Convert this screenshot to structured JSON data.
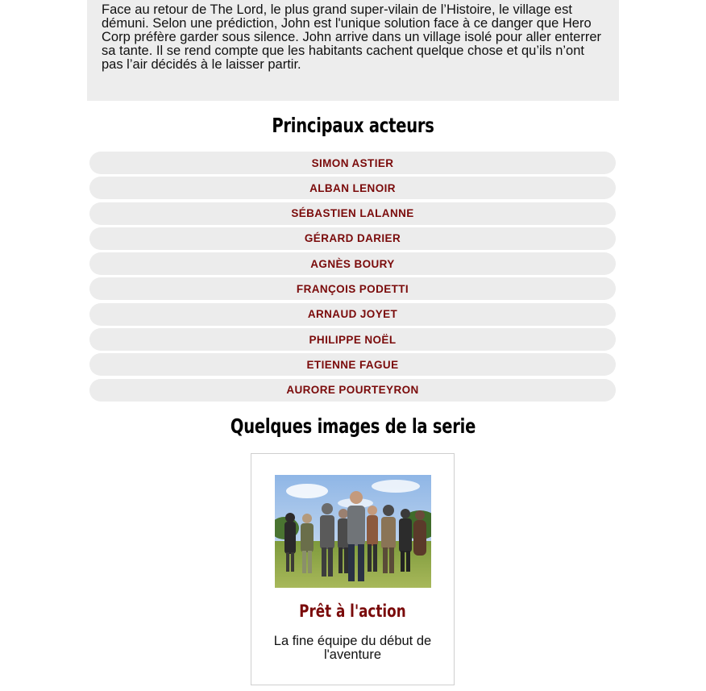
{
  "synopsis": {
    "text": "Face au retour de The Lord, le plus grand super-vilain de l’Histoire, le village est démuni. Selon une prédiction, John est l'unique solution face à ce danger que Hero Corp préfère garder sous silence. John arrive dans un village isolé pour aller enterrer sa tante. Il se rend compte que les habitants cachent quelque chose et qu’ils n’ont pas l’air décidés à le laisser partir."
  },
  "actors_section": {
    "title": "Principaux acteurs",
    "actors": [
      "SIMON ASTIER",
      "ALBAN LENOIR",
      "SÉBASTIEN LALANNE",
      "GÉRARD DARIER",
      "AGNÈS BOURY",
      "FRANÇOIS PODETTI",
      "ARNAUD JOYET",
      "PHILIPPE NOËL",
      "ETIENNE FAGUE",
      "AURORE POURTEYRON"
    ]
  },
  "images_section": {
    "title": "Quelques images de la serie",
    "cards": [
      {
        "title": "Prêt à l'action",
        "caption": "La fine équipe du début de l'aventure"
      }
    ]
  },
  "colors": {
    "accent": "#7a0a0a",
    "pill_bg": "#ececec",
    "synopsis_bg": "#ededed"
  }
}
